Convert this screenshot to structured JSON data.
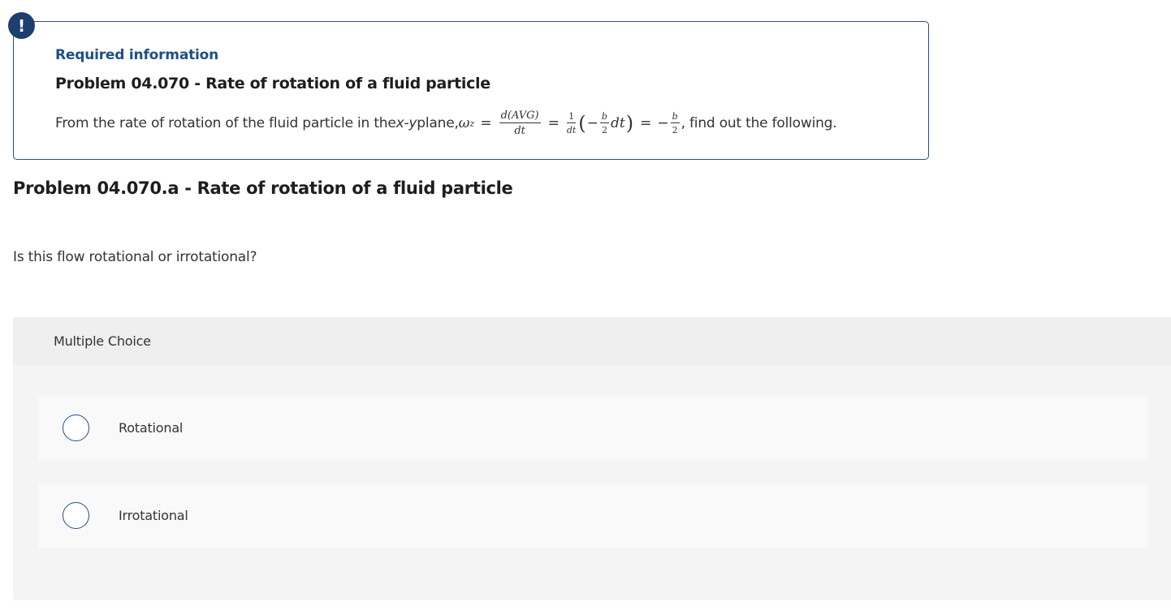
{
  "alert": {
    "icon": "exclamation-icon",
    "symbol": "!",
    "color": "#1d3f6e"
  },
  "info": {
    "heading": "Required information",
    "title": "Problem 04.070 - Rate of rotation of a fluid particle",
    "text_before": "From the rate of rotation of the fluid particle in the ",
    "xy": "x-y",
    "text_middle": " plane, ",
    "equation": {
      "omega": "ω",
      "omega_sub": "z",
      "equals": "=",
      "frac1_num": "d(AVG)",
      "frac1_den": "dt",
      "frac2_num": "1",
      "frac2_den": "dt",
      "paren_open": "(",
      "minus": "−",
      "frac3_num": "b",
      "frac3_den": "2",
      "dt": "dt",
      "paren_close": ")",
      "neg_minus": "−",
      "frac4_num": "b",
      "frac4_den": "2"
    },
    "text_after": " , find out the following."
  },
  "problem": {
    "title": "Problem 04.070.a - Rate of rotation of a fluid particle",
    "question": "Is this flow rotational or irrotational?"
  },
  "multiple_choice": {
    "label": "Multiple Choice",
    "options": [
      {
        "label": "Rotational"
      },
      {
        "label": "Irrotational"
      }
    ]
  },
  "colors": {
    "accent": "#1f4f86",
    "border": "#2c4f7c",
    "panel_bg": "#f4f4f4",
    "header_bg": "#efefef",
    "option_bg": "#f9f9f9"
  }
}
